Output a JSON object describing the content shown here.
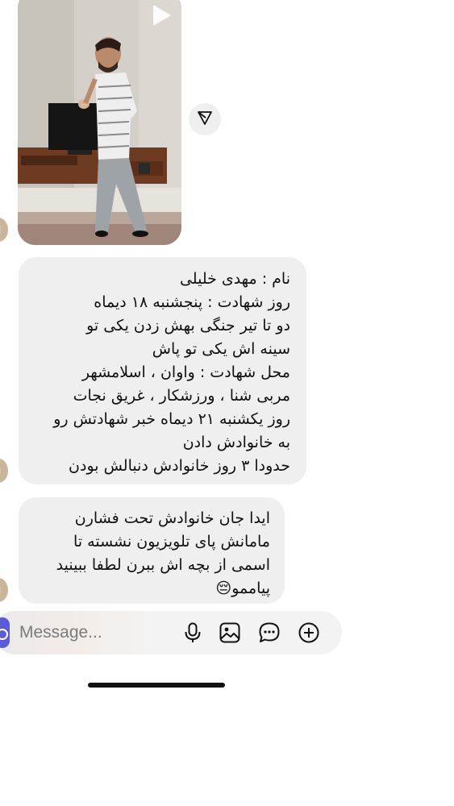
{
  "video": {
    "thumbnail": "man-walking-in-living-room",
    "play_icon": "play-icon"
  },
  "share": {
    "icon": "send-icon"
  },
  "messages": [
    {
      "text": "نام : مهدی خلیلی\nروز شهادت : پنجشنبه ۱۸ دیماه\nدو تا تیر جنگی بهش زدن یکی تو\nسینه اش یکی تو پاش\nمحل شهادت : واوان ، اسلامشهر\nمربی شنا ، ورزشکار ، غریق نجات\nروز یکشنبه ۲۱ دیماه خبر شهادتش رو\nبه خانوادش دادن\nحدودا ۳ روز خانوادش دنبالش بودن"
    },
    {
      "text": "ایدا جان خانوادش تحت فشارن\nمامانش پای تلویزیون نشسته تا\nاسمی از بچه اش ببرن لطفا ببینید\nپیاممو😔"
    }
  ],
  "composer": {
    "placeholder": "Message...",
    "icons": [
      "camera-icon",
      "microphone-icon",
      "gallery-icon",
      "sticker-icon",
      "add-icon"
    ]
  },
  "colors": {
    "bubble_bg": "#efefef",
    "camera_button": "#5b5bd6",
    "text": "#111111",
    "placeholder": "#7b7b7b"
  }
}
